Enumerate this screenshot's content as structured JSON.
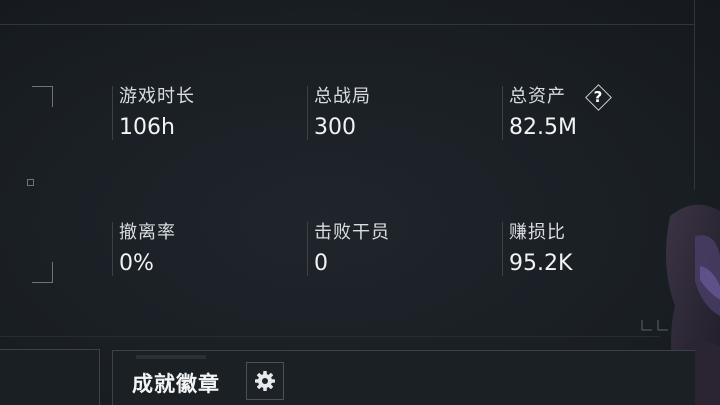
{
  "stats": [
    {
      "label": "游戏时长",
      "value": "106h"
    },
    {
      "label": "总战局",
      "value": "300"
    },
    {
      "label": "总资产",
      "value": "82.5M",
      "help": "?"
    },
    {
      "label": "撤离率",
      "value": "0%"
    },
    {
      "label": "击败干员",
      "value": "0"
    },
    {
      "label": "赚损比",
      "value": "95.2K"
    }
  ],
  "achievement": {
    "title": "成就徽章",
    "settings_icon": "gear-icon"
  },
  "colors": {
    "background": "#181d22",
    "text": "#e9ecee",
    "divider": "#3a4147"
  }
}
